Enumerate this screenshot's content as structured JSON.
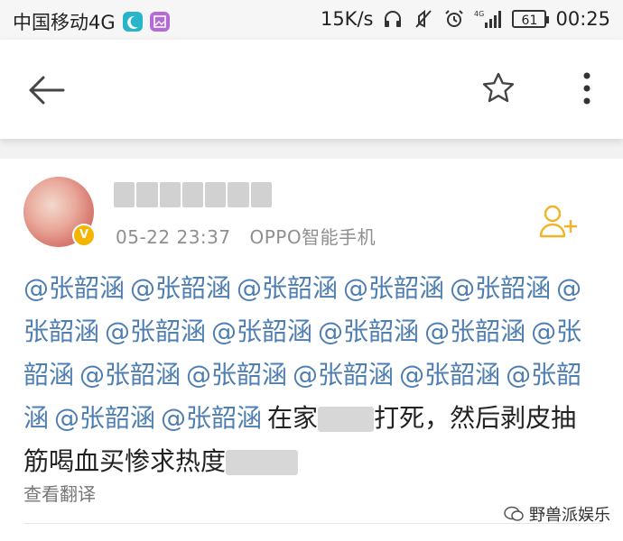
{
  "status_bar": {
    "carrier": "中国移动4G",
    "speed": "15K/s",
    "signal_label": "4G",
    "battery": "61",
    "time": "00:25"
  },
  "post": {
    "timestamp": "05-22 23:37",
    "source": "OPPO智能手机",
    "mention": "@张韶涵",
    "mentions_count": 18,
    "text_part1": "在家",
    "text_part2": "打死，然后剥皮抽筋喝血买惨求热度",
    "translate_label": "查看翻译"
  },
  "watermark": {
    "label": "野兽派娱乐"
  },
  "colors": {
    "mention": "#4f7fb0",
    "follow_icon": "#f0b429",
    "verified_badge": "#f4b400"
  }
}
